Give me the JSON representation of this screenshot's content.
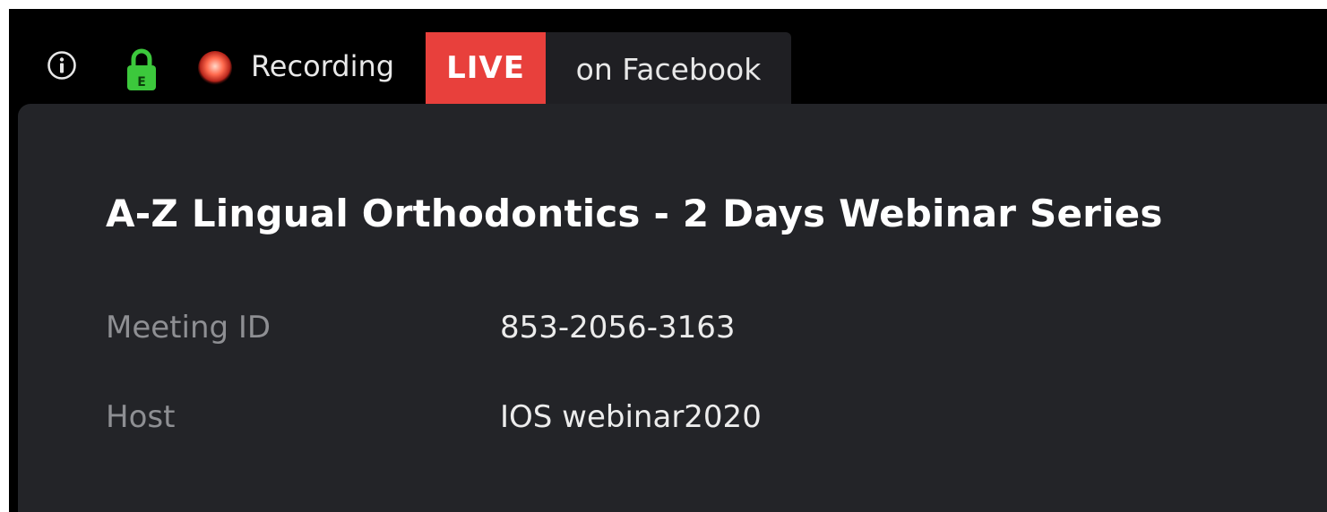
{
  "status_bar": {
    "info_icon": "info-icon",
    "lock_icon": "lock-icon",
    "lock_letter": "E",
    "recording_icon": "recording-dot-icon",
    "recording_label": "Recording",
    "live_badge": "LIVE",
    "live_destination": "on Facebook"
  },
  "meeting": {
    "title": "A-Z Lingual Orthodontics - 2 Days Webinar Series",
    "rows": [
      {
        "label": "Meeting ID",
        "value": "853-2056-3163"
      },
      {
        "label": "Host",
        "value": "IOS webinar2020"
      }
    ]
  },
  "colors": {
    "live_red": "#e8403c",
    "lock_green": "#3cc83c",
    "panel_bg": "#232428",
    "bar_bg": "#000000"
  }
}
